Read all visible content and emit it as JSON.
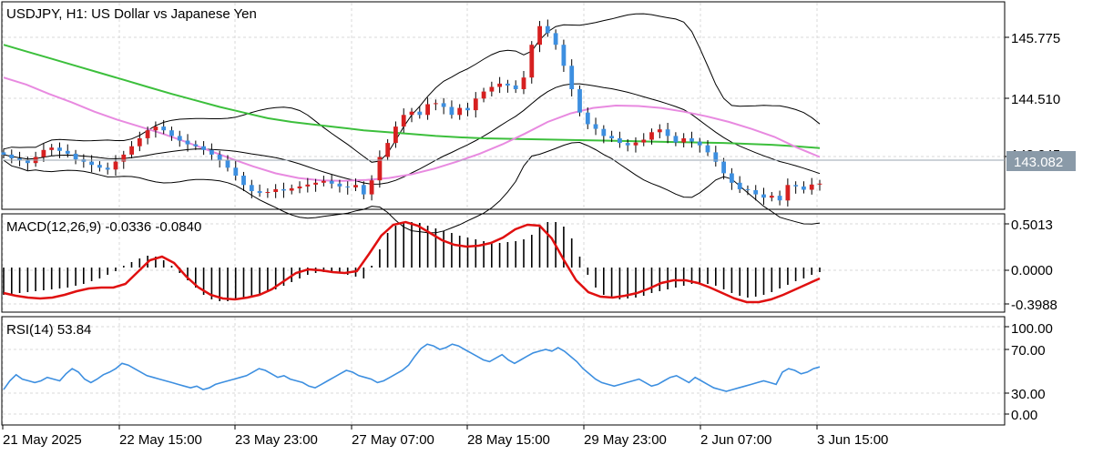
{
  "colors": {
    "bull": "#d62020",
    "bear": "#3d8fe0",
    "ma_long": "#3cbf3c",
    "ma_pink": "#e88ae0",
    "bands": "#000000",
    "macd_signal": "#e01010",
    "rsi": "#3d8fe0",
    "grid": "#d8d8d8",
    "badge_bg": "#8a9aa8"
  },
  "price_panel": {
    "title": "USDJPY, H1:  US Dollar vs Japanese Yen",
    "y_ticks": [
      "145.775",
      "144.510",
      "143.245"
    ],
    "current_price": "143.082"
  },
  "macd_panel": {
    "label": "MACD(12,26,9) -0.0336 -0.0840",
    "y_ticks": [
      "0.5013",
      "0.0000",
      "-0.3988"
    ]
  },
  "rsi_panel": {
    "label": "RSI(14) 53.84",
    "y_ticks": [
      "100.00",
      "70.00",
      "30.00",
      "0.00"
    ]
  },
  "x_axis": {
    "labels": [
      "21 May 2025",
      "22 May 15:00",
      "23 May 23:00",
      "27 May 07:00",
      "28 May 15:00",
      "29 May 23:00",
      "2 Jun 07:00",
      "3 Jun 15:00"
    ]
  },
  "chart_data": [
    {
      "type": "line",
      "title": "USDJPY, H1:  US Dollar vs Japanese Yen",
      "series": [
        {
          "name": "",
          "role": "close_approx",
          "values": [
            143.7,
            143.62,
            143.58,
            143.52,
            143.65,
            143.8,
            143.85,
            143.78,
            143.72,
            143.6,
            143.55,
            143.48,
            143.42,
            143.38,
            143.55,
            143.7,
            143.88,
            144.05,
            144.22,
            144.3,
            144.22,
            144.1,
            144.0,
            143.92,
            143.88,
            143.8,
            143.7,
            143.58,
            143.42,
            143.25,
            143.05,
            142.92,
            142.88,
            142.9,
            142.96,
            142.93,
            142.98,
            143.02,
            143.06,
            143.1,
            143.14,
            143.08,
            143.02,
            143.0,
            143.05,
            142.85,
            143.15,
            143.65,
            143.95,
            144.3,
            144.55,
            144.62,
            144.55,
            144.78,
            144.8,
            144.72,
            144.55,
            144.7,
            144.65,
            144.9,
            145.05,
            145.15,
            145.22,
            145.18,
            145.1,
            145.35,
            146.05,
            146.45,
            146.3,
            146.05,
            145.6,
            145.1,
            144.6,
            144.35,
            144.25,
            144.1,
            144.05,
            143.95,
            143.9,
            143.96,
            144.02,
            144.18,
            144.24,
            144.1,
            143.96,
            144.05,
            143.98,
            143.9,
            143.75,
            143.55,
            143.3,
            143.1,
            142.96,
            142.94,
            142.85,
            142.78,
            142.82,
            142.72,
            143.05,
            143.02,
            142.95,
            143.06,
            143.08
          ]
        },
        {
          "name": "",
          "role": "ma_long_approx",
          "values": [
            146.05,
            145.9,
            145.75,
            145.6,
            145.45,
            145.3,
            145.15,
            145.0,
            144.86,
            144.72,
            144.6,
            144.48,
            144.4,
            144.34,
            144.28,
            144.22,
            144.18,
            144.14,
            144.1,
            144.07,
            144.05,
            144.04,
            144.03,
            144.02,
            144.01,
            144.0,
            143.99,
            143.98,
            143.97,
            143.96,
            143.95,
            143.93,
            143.91,
            143.88,
            143.84
          ]
        },
        {
          "name": "",
          "role": "ma_pink_approx",
          "values": [
            145.35,
            145.2,
            145.0,
            144.82,
            144.62,
            144.45,
            144.3,
            144.15,
            143.98,
            143.8,
            143.62,
            143.45,
            143.3,
            143.2,
            143.15,
            143.14,
            143.16,
            143.2,
            143.28,
            143.4,
            143.55,
            143.72,
            143.92,
            144.15,
            144.4,
            144.58,
            144.7,
            144.75,
            144.74,
            144.7,
            144.62,
            144.52,
            144.4,
            144.25,
            144.08,
            143.85,
            143.65
          ]
        }
      ],
      "ylim": [
        142.55,
        146.95
      ],
      "grid": true
    },
    {
      "type": "bar",
      "title": "MACD(12,26,9) -0.0336 -0.0840",
      "series": [
        {
          "name": "",
          "role": "histogram_approx",
          "values": [
            -0.3,
            -0.29,
            -0.28,
            -0.27,
            -0.26,
            -0.25,
            -0.24,
            -0.23,
            -0.22,
            -0.2,
            -0.18,
            -0.15,
            -0.12,
            -0.08,
            -0.04,
            0.02,
            0.06,
            0.1,
            0.13,
            0.12,
            0.08,
            0.02,
            -0.06,
            -0.14,
            -0.22,
            -0.3,
            -0.35,
            -0.37,
            -0.37,
            -0.36,
            -0.34,
            -0.32,
            -0.3,
            -0.27,
            -0.24,
            -0.2,
            -0.16,
            -0.12,
            -0.08,
            -0.06,
            -0.05,
            -0.05,
            -0.06,
            -0.08,
            -0.1,
            -0.12,
            0.02,
            0.2,
            0.38,
            0.46,
            0.49,
            0.5,
            0.49,
            0.46,
            0.43,
            0.4,
            0.38,
            0.35,
            0.33,
            0.31,
            0.29,
            0.27,
            0.27,
            0.28,
            0.29,
            0.31,
            0.36,
            0.45,
            0.5,
            0.5,
            0.45,
            0.32,
            0.12,
            -0.08,
            -0.22,
            -0.3,
            -0.34,
            -0.35,
            -0.34,
            -0.33,
            -0.31,
            -0.28,
            -0.26,
            -0.24,
            -0.22,
            -0.2,
            -0.18,
            -0.17,
            -0.18,
            -0.2,
            -0.24,
            -0.28,
            -0.31,
            -0.33,
            -0.32,
            -0.3,
            -0.27,
            -0.23,
            -0.19,
            -0.15,
            -0.12,
            -0.08,
            -0.05
          ]
        },
        {
          "name": "",
          "role": "signal_approx",
          "values": [
            -0.28,
            -0.31,
            -0.33,
            -0.34,
            -0.33,
            -0.3,
            -0.26,
            -0.23,
            -0.22,
            -0.22,
            -0.18,
            -0.05,
            0.08,
            0.12,
            0.05,
            -0.1,
            -0.22,
            -0.3,
            -0.34,
            -0.35,
            -0.33,
            -0.3,
            -0.24,
            -0.15,
            -0.06,
            -0.02,
            -0.03,
            -0.05,
            -0.06,
            -0.04,
            0.15,
            0.35,
            0.47,
            0.5,
            0.46,
            0.38,
            0.3,
            0.25,
            0.23,
            0.24,
            0.27,
            0.33,
            0.42,
            0.47,
            0.46,
            0.32,
            0.08,
            -0.14,
            -0.27,
            -0.32,
            -0.33,
            -0.31,
            -0.28,
            -0.23,
            -0.17,
            -0.14,
            -0.14,
            -0.17,
            -0.22,
            -0.28,
            -0.34,
            -0.38,
            -0.38,
            -0.35,
            -0.3,
            -0.24,
            -0.18,
            -0.12
          ]
        }
      ],
      "ylim": [
        -0.48,
        0.58
      ],
      "grid": true
    },
    {
      "type": "line",
      "title": "RSI(14) 53.84",
      "series": [
        {
          "name": "",
          "values": [
            28,
            38,
            45,
            40,
            38,
            36,
            38,
            42,
            40,
            38,
            46,
            52,
            48,
            40,
            36,
            40,
            45,
            48,
            52,
            58,
            56,
            52,
            48,
            44,
            42,
            40,
            38,
            36,
            34,
            32,
            30,
            32,
            28,
            30,
            34,
            36,
            38,
            40,
            42,
            44,
            48,
            52,
            50,
            46,
            42,
            44,
            40,
            38,
            36,
            32,
            30,
            34,
            38,
            42,
            46,
            50,
            48,
            44,
            42,
            40,
            36,
            38,
            42,
            46,
            50,
            56,
            66,
            75,
            80,
            78,
            74,
            76,
            80,
            78,
            74,
            70,
            66,
            62,
            60,
            64,
            68,
            62,
            58,
            62,
            66,
            70,
            72,
            74,
            72,
            76,
            72,
            66,
            60,
            52,
            46,
            40,
            36,
            34,
            32,
            34,
            36,
            38,
            40,
            36,
            32,
            34,
            38,
            42,
            44,
            40,
            36,
            42,
            38,
            34,
            30,
            28,
            26,
            28,
            30,
            32,
            34,
            36,
            38,
            36,
            34,
            48,
            52,
            50,
            46,
            48,
            52,
            54
          ]
        }
      ],
      "ylim": [
        0,
        100
      ],
      "grid": true
    }
  ]
}
